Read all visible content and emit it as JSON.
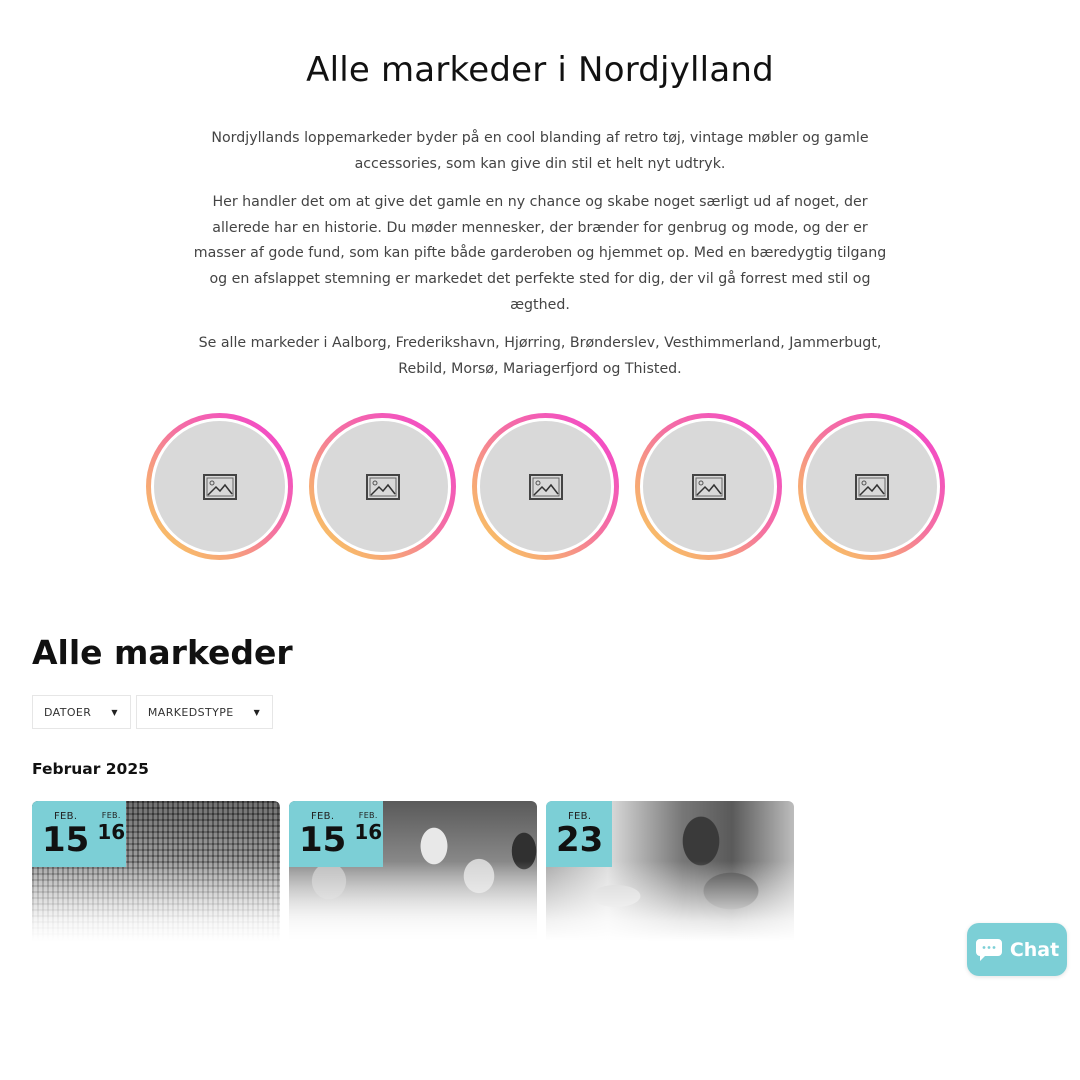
{
  "header": {
    "title": "Alle markeder i Nordjylland",
    "paragraphs": [
      "Nordjyllands loppemarkeder byder på en cool blanding af retro tøj, vintage møbler og gamle accessories, som kan give din stil et helt nyt udtryk.",
      "Her handler det om at give det gamle en ny chance og skabe noget særligt ud af noget, der allerede har en historie. Du møder mennesker, der brænder for genbrug og mode, og der er masser af gode fund, som kan pifte både garderoben og hjemmet op. Med en bæredygtig tilgang og en afslappet stemning er markedet det perfekte sted for dig, der vil gå forrest med stil og ægthed.",
      "Se alle markeder i Aalborg, Frederikshavn, Hjørring, Brønderslev, Vesthimmerland, Jammerbugt, Rebild, Morsø, Mariagerfjord og Thisted."
    ]
  },
  "circles": [
    {
      "icon": "image-placeholder-icon"
    },
    {
      "icon": "image-placeholder-icon"
    },
    {
      "icon": "image-placeholder-icon"
    },
    {
      "icon": "image-placeholder-icon"
    },
    {
      "icon": "image-placeholder-icon"
    }
  ],
  "markets": {
    "title": "Alle markeder",
    "filters": [
      {
        "label": "DATOER",
        "icon": "caret-down-icon"
      },
      {
        "label": "MARKEDSTYPE",
        "icon": "caret-down-icon"
      }
    ],
    "month_heading": "Februar 2025",
    "events": [
      {
        "start_month": "FEB.",
        "start_day": "15",
        "end_month": "FEB.",
        "end_day": "16",
        "image": "crowd-market-photo"
      },
      {
        "start_month": "FEB.",
        "start_day": "15",
        "end_month": "FEB.",
        "end_day": "16",
        "image": "glassware-photo"
      },
      {
        "start_month": "FEB.",
        "start_day": "23",
        "image": "gramophone-photo"
      }
    ]
  },
  "chat": {
    "label": "Chat",
    "icon": "chat-bubble-icon"
  },
  "colors": {
    "accent": "#7ccfd6",
    "ring_gradient": [
      "#f23fd3",
      "#f46fa3",
      "#f7a37a",
      "#f8d05a"
    ],
    "placeholder": "#d9d9d9"
  }
}
